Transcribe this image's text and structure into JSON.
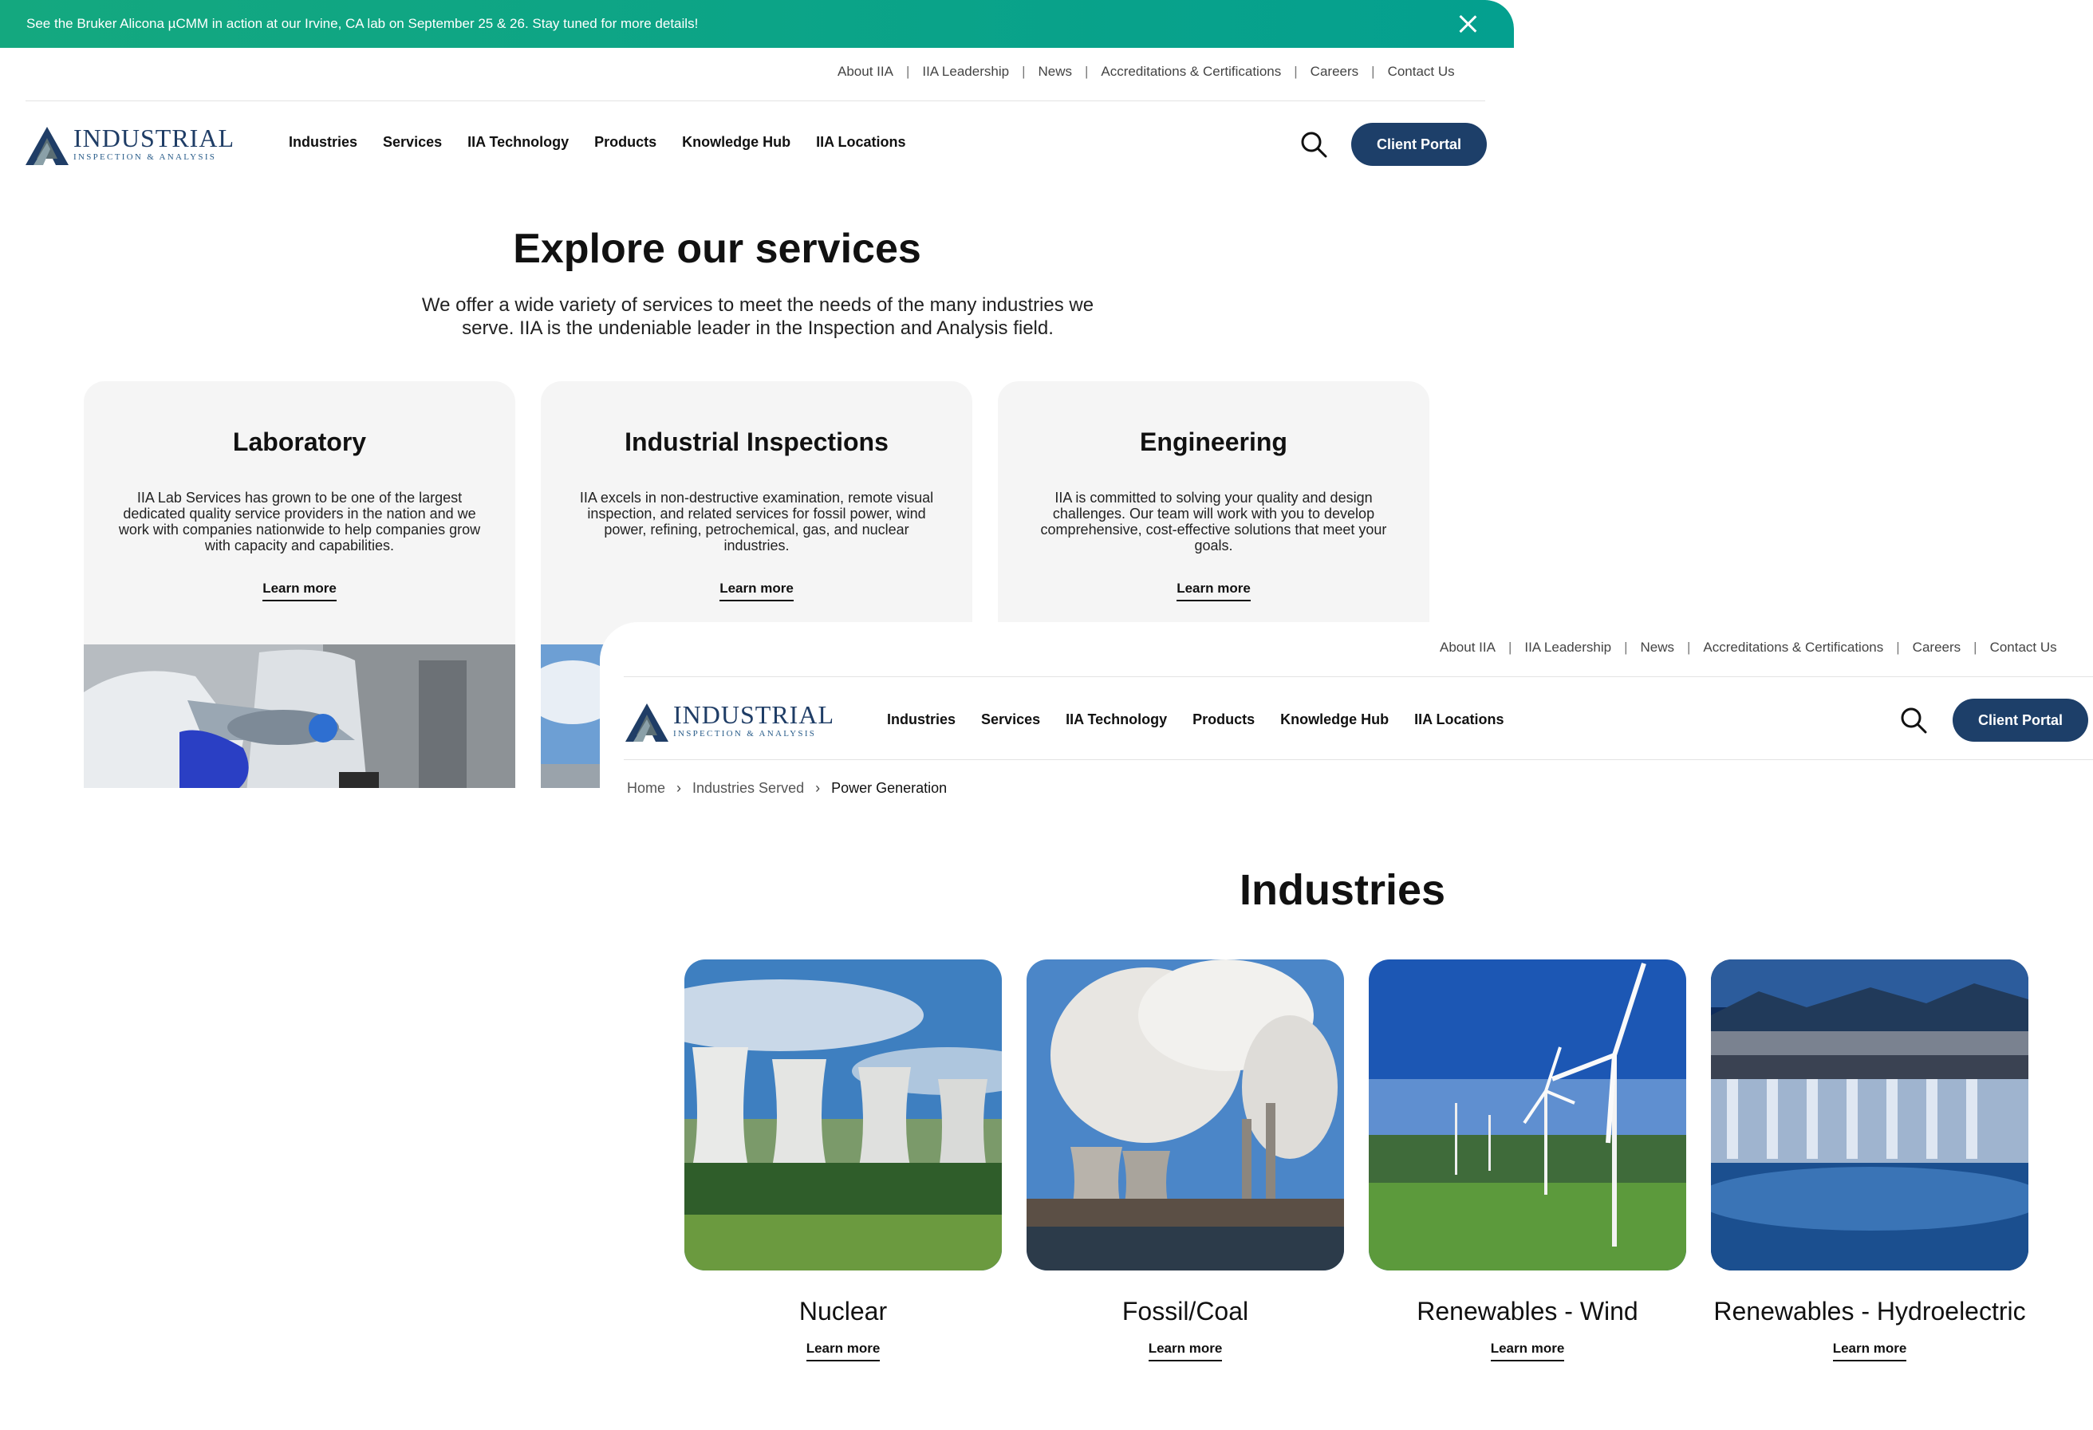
{
  "announcement": {
    "text": "See the Bruker Alicona µCMM in action at our Irvine, CA lab on September 25 & 26. Stay tuned for more details!",
    "close_icon": "close-icon"
  },
  "utility_nav": [
    "About IIA",
    "IIA Leadership",
    "News",
    "Accreditations & Certifications",
    "Careers",
    "Contact Us"
  ],
  "brand": {
    "word": "INDUSTRIAL",
    "sub": "INSPECTION & ANALYSIS",
    "color": "#1f3d66"
  },
  "main_nav": [
    "Industries",
    "Services",
    "IIA Technology",
    "Products",
    "Knowledge Hub",
    "IIA Locations"
  ],
  "client_portal": "Client Portal",
  "services_page": {
    "title": "Explore our services",
    "subtitle": "We offer a wide variety of services to meet the needs of the many industries we serve. IIA is the undeniable leader in the Inspection and Analysis field.",
    "cards": [
      {
        "title": "Laboratory",
        "text": "IIA Lab Services has grown to be one of the largest dedicated quality service providers in the nation and we work with companies nationwide to help companies grow with capacity and capabilities.",
        "link": "Learn more"
      },
      {
        "title": "Industrial Inspections",
        "text": "IIA excels in non-destructive examination, remote visual inspection, and related services for fossil power, wind power, refining, petrochemical, gas, and nuclear industries.",
        "link": "Learn more"
      },
      {
        "title": "Engineering",
        "text": "IIA is committed to solving your quality and design challenges. Our team will work with you to develop comprehensive, cost-effective solutions that meet your goals.",
        "link": "Learn more"
      }
    ]
  },
  "industries_page": {
    "breadcrumb": [
      "Home",
      "Industries Served",
      "Power Generation"
    ],
    "title": "Industries",
    "cards": [
      {
        "title": "Nuclear",
        "link": "Learn more"
      },
      {
        "title": "Fossil/Coal",
        "link": "Learn more"
      },
      {
        "title": "Renewables - Wind",
        "link": "Learn more"
      },
      {
        "title": "Renewables - Hydroelectric",
        "link": "Learn more"
      }
    ]
  },
  "colors": {
    "announcement": "#04a08f",
    "portal": "#1d3f69",
    "card_bg": "#f5f5f5"
  }
}
